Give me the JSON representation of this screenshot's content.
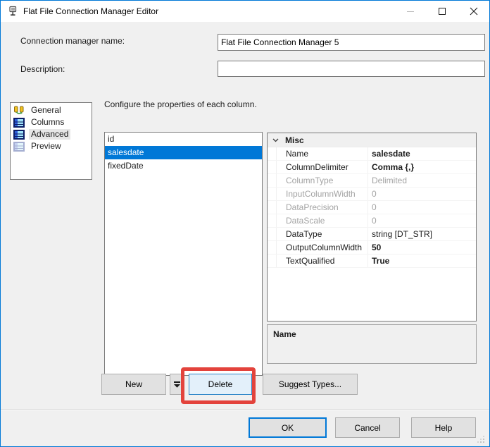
{
  "window": {
    "title": "Flat File Connection Manager Editor"
  },
  "header": {
    "connection_name_label": "Connection manager name:",
    "connection_name_value": "Flat File Connection Manager 5",
    "description_label": "Description:",
    "description_value": ""
  },
  "sidebar": {
    "items": [
      {
        "label": "General",
        "icon": "connection-pair-icon",
        "selected": false
      },
      {
        "label": "Columns",
        "icon": "table-icon",
        "selected": false
      },
      {
        "label": "Advanced",
        "icon": "table-icon",
        "selected": true
      },
      {
        "label": "Preview",
        "icon": "table-faded-icon",
        "selected": false
      }
    ]
  },
  "main": {
    "instruction": "Configure the properties of each column.",
    "column_list": [
      "id",
      "salesdate",
      "fixedDate"
    ],
    "selected_column": "salesdate"
  },
  "property_grid": {
    "category": "Misc",
    "rows": [
      {
        "name": "Name",
        "value": "salesdate",
        "style": "bold"
      },
      {
        "name": "ColumnDelimiter",
        "value": "Comma {,}",
        "style": "bold"
      },
      {
        "name": "ColumnType",
        "value": "Delimited",
        "style": "disabled"
      },
      {
        "name": "InputColumnWidth",
        "value": "0",
        "style": "disabled"
      },
      {
        "name": "DataPrecision",
        "value": "0",
        "style": "disabled"
      },
      {
        "name": "DataScale",
        "value": "0",
        "style": "disabled"
      },
      {
        "name": "DataType",
        "value": "string [DT_STR]",
        "style": "normal"
      },
      {
        "name": "OutputColumnWidth",
        "value": "50",
        "style": "bold"
      },
      {
        "name": "TextQualified",
        "value": "True",
        "style": "bold"
      }
    ],
    "description_title": "Name"
  },
  "actions": {
    "new_label": "New",
    "delete_label": "Delete",
    "suggest_types_label": "Suggest Types..."
  },
  "footer": {
    "ok_label": "OK",
    "cancel_label": "Cancel",
    "help_label": "Help"
  },
  "annotation": {
    "highlighted_button": "Delete",
    "highlight_color": "#e3433c"
  },
  "colors": {
    "accent_blue": "#0078d7",
    "selection_blue": "#0078d7",
    "dialog_bg": "#f0f0f0",
    "delete_button_bg": "#e3f0fa"
  }
}
